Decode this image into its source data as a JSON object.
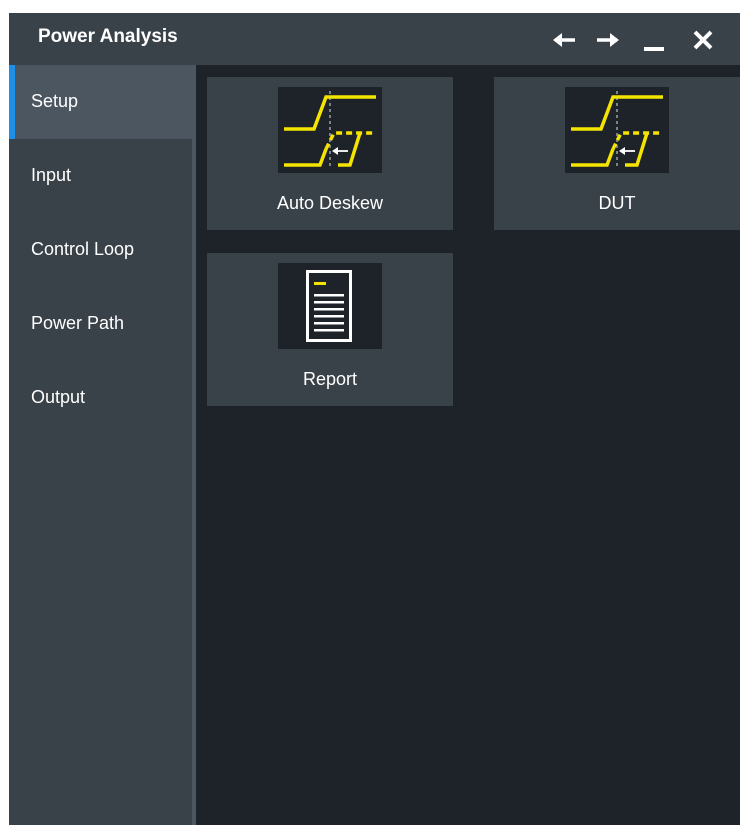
{
  "window": {
    "title": "Power Analysis",
    "controls": [
      "arrow-left-icon",
      "arrow-right-icon",
      "minimize-icon",
      "close-icon"
    ]
  },
  "sidebar": {
    "items": [
      {
        "label": "Setup",
        "active": true
      },
      {
        "label": "Input",
        "active": false
      },
      {
        "label": "Control Loop",
        "active": false
      },
      {
        "label": "Power Path",
        "active": false
      },
      {
        "label": "Output",
        "active": false
      }
    ]
  },
  "tiles": [
    {
      "label": "Auto Deskew",
      "icon": "deskew-waveform-icon"
    },
    {
      "label": "DUT",
      "icon": "deskew-waveform-icon"
    },
    {
      "label": "Report",
      "icon": "report-document-icon"
    }
  ],
  "colors": {
    "accent": "#1e8fe6",
    "waveform": "#f5e400",
    "titlebar": "#394149",
    "background": "#1d2328"
  }
}
